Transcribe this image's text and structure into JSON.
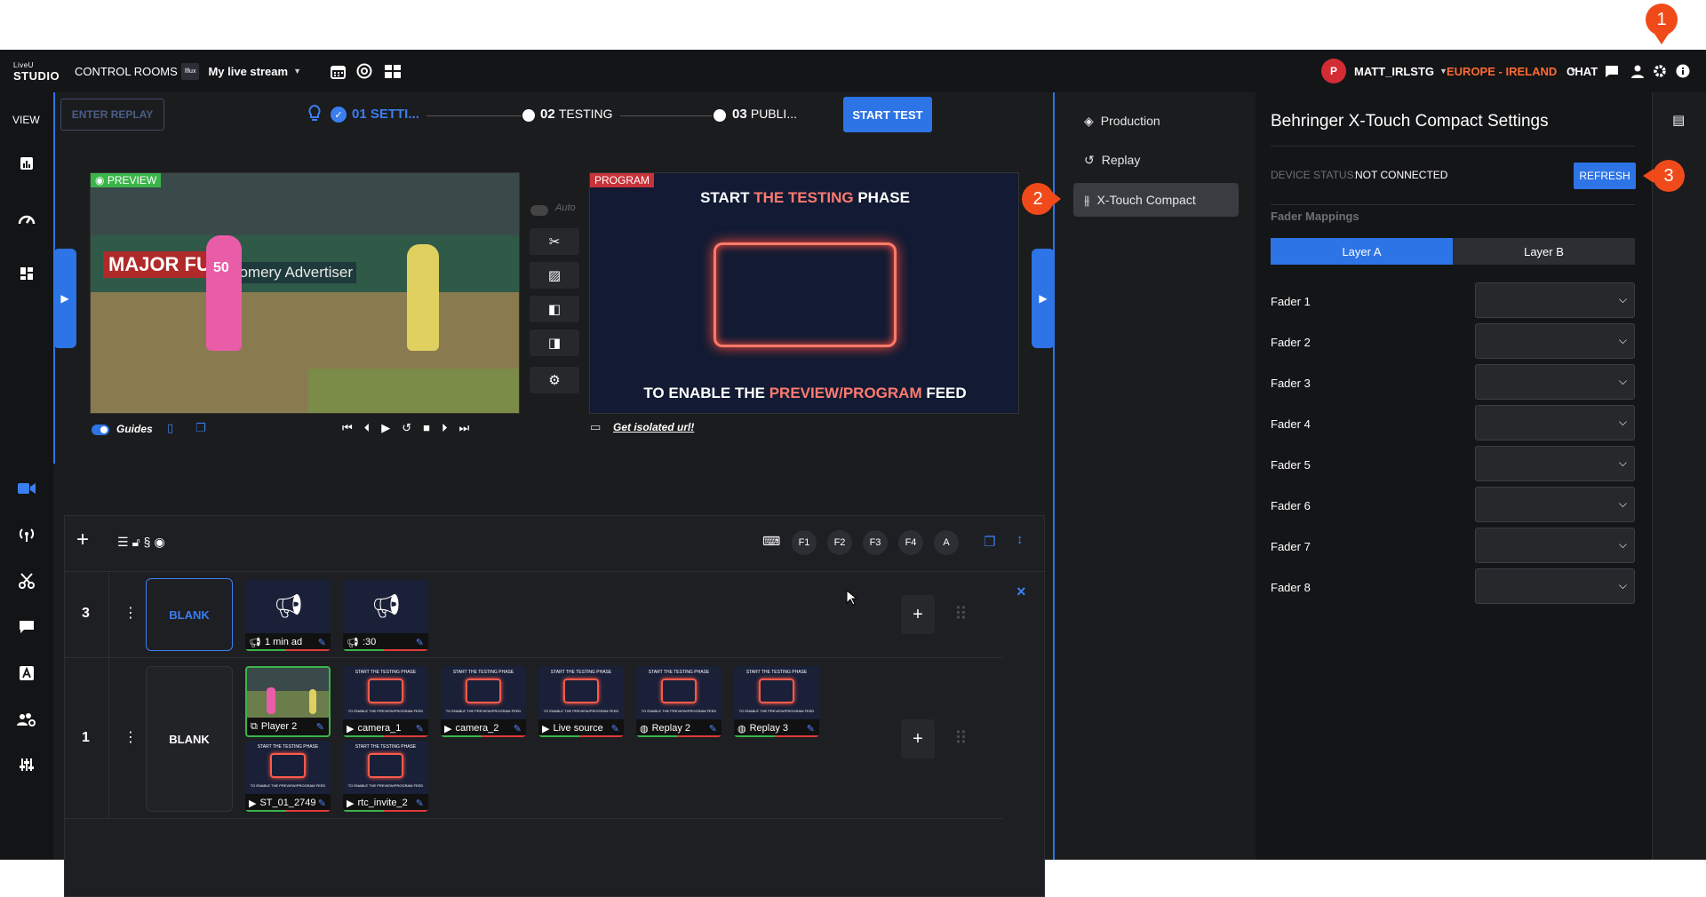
{
  "topbar": {
    "logo_top": "LiveU",
    "logo_bottom": "STUDIO",
    "control_rooms": "CONTROL ROOMS",
    "stream_badge": "lflux",
    "stream_name": "My live stream",
    "user_initial": "P",
    "user_name": "MATT_IRLSTG",
    "region": "EUROPE - IRELAND",
    "chat": "CHAT"
  },
  "sidebar": {
    "view_label": "VIEW"
  },
  "workflow": {
    "enter_replay": "ENTER REPLAY",
    "step1": "01 SETTI...",
    "step2_num": "02",
    "step2_label": "TESTING",
    "step3_num": "03",
    "step3_label": "PUBLI...",
    "start_test": "START TEST"
  },
  "preview": {
    "tag": "PREVIEW",
    "auto_label": "Auto",
    "guides_label": "Guides",
    "jersey_number": "50",
    "ad_banner": "MAJOR FUN",
    "ad_banner2": "gomery Advertiser"
  },
  "program": {
    "tag": "PROGRAM",
    "title_pre": "START ",
    "title_highlight": "THE TESTING",
    "title_post": " PHASE",
    "bottom_pre": "TO ENABLE THE ",
    "bottom_highlight": "PREVIEW/PROGRAM",
    "bottom_post": " FEED",
    "isolated_url": "Get isolated url!"
  },
  "grid": {
    "fkeys": [
      "F1",
      "F2",
      "F3",
      "F4",
      "A"
    ],
    "rows": [
      {
        "number": "3",
        "blank": "BLANK",
        "tiles": [
          "1 min ad",
          ":30"
        ]
      },
      {
        "number": "1",
        "blank": "BLANK",
        "tiles": [
          "Player 2",
          "camera_1",
          "camera_2",
          "Live source",
          "Replay 2",
          "Replay 3",
          "ST_01_2749",
          "rtc_invite_2"
        ]
      }
    ]
  },
  "settings_nav": {
    "items": [
      "Production",
      "Replay",
      "X-Touch Compact"
    ]
  },
  "settings": {
    "title": "Behringer X-Touch Compact Settings",
    "device_status_label": "DEVICE STATUS:",
    "device_status_value": "NOT CONNECTED",
    "refresh": "REFRESH",
    "fader_mappings": "Fader Mappings",
    "layer_a": "Layer A",
    "layer_b": "Layer B",
    "faders": [
      "Fader 1",
      "Fader 2",
      "Fader 3",
      "Fader 4",
      "Fader 5",
      "Fader 6",
      "Fader 7",
      "Fader 8"
    ]
  },
  "markers": [
    "1",
    "2",
    "3"
  ],
  "colors": {
    "accent_blue": "#2d74e6",
    "region_orange": "#ff6a33",
    "marker_orange": "#f04a1a",
    "program_red": "#ff5a4a"
  }
}
